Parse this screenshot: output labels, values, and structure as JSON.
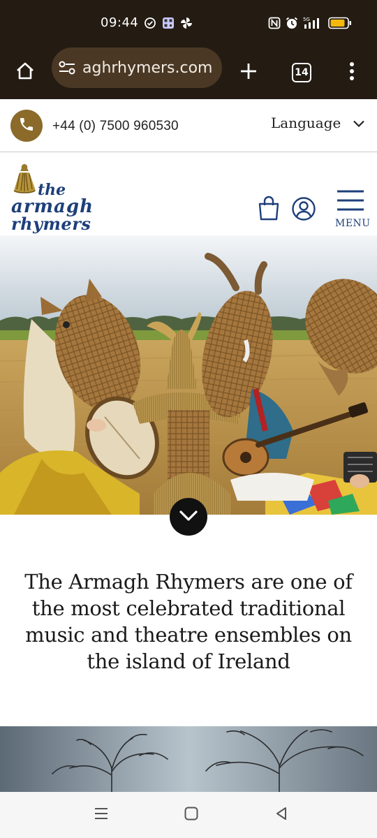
{
  "status_bar": {
    "time": "09:44",
    "network": "5G",
    "icons": [
      "check-circle-icon",
      "qr-icon",
      "pinwheel-icon",
      "nfc-icon",
      "alarm-icon",
      "signal-icon",
      "battery-icon"
    ]
  },
  "browser": {
    "url": "aghrhymers.com",
    "tab_count": "14",
    "icons": [
      "home-icon",
      "site-settings-icon",
      "new-tab-icon",
      "tab-switcher-icon",
      "more-options-icon"
    ]
  },
  "site": {
    "phone": "+44 (0) 7500 960530",
    "language_label": "Language",
    "logo": {
      "line1": "the",
      "line2": "armagh",
      "line3": "rhymers"
    },
    "menu_label": "MENU",
    "intro_text": "The Armagh Rhymers are one of the most celebrated traditional music and theatre ensembles on the island of Ireland"
  },
  "colors": {
    "browser_chrome": "#241c13",
    "url_pill": "#4a3825",
    "brand_gold": "#8b6a2a",
    "brand_blue": "#1e3f7a"
  },
  "nav_bar": {
    "icons": [
      "recent-apps-icon",
      "home-square-icon",
      "back-triangle-icon"
    ]
  }
}
